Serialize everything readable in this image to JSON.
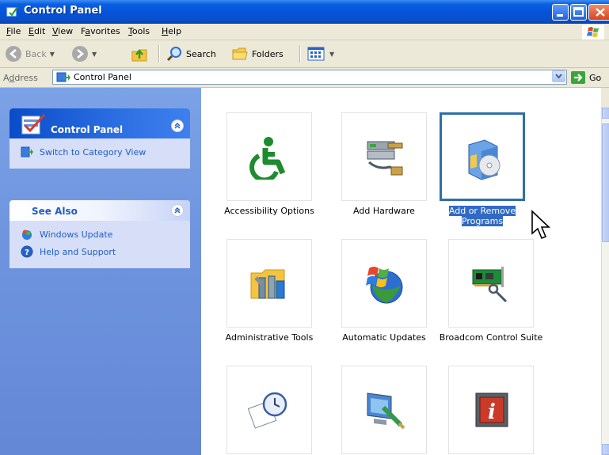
{
  "window": {
    "title": "Control Panel"
  },
  "menu": [
    {
      "label": "File",
      "mnemonic": "F",
      "rest": "ile"
    },
    {
      "label": "Edit",
      "mnemonic": "E",
      "rest": "dit"
    },
    {
      "label": "View",
      "mnemonic": "V",
      "rest": "iew"
    },
    {
      "label": "Favorites",
      "pre": "F",
      "mnemonic": "a",
      "rest": "vorites"
    },
    {
      "label": "Tools",
      "mnemonic": "T",
      "rest": "ools"
    },
    {
      "label": "Help",
      "mnemonic": "H",
      "rest": "elp"
    }
  ],
  "toolbar": {
    "back_label": "Back",
    "search_label": "Search",
    "folders_label": "Folders"
  },
  "address": {
    "label_pre": "A",
    "label_mnemonic": "d",
    "label_rest": "dress",
    "value": "Control Panel",
    "go_label": "Go"
  },
  "taskpane": {
    "control_panel": {
      "title": "Control Panel",
      "links": [
        {
          "label": "Switch to Category View",
          "icon": "category-view-icon"
        }
      ]
    },
    "see_also": {
      "title": "See Also",
      "links": [
        {
          "label": "Windows Update",
          "icon": "windows-update-icon"
        },
        {
          "label": "Help and Support",
          "icon": "help-icon"
        }
      ]
    }
  },
  "items": [
    {
      "label": "Accessibility Options",
      "icon": "accessibility-icon"
    },
    {
      "label": "Add Hardware",
      "icon": "add-hardware-icon"
    },
    {
      "label_line1": "Add or Remove",
      "label_line2": "Programs",
      "icon": "add-remove-programs-icon",
      "selected": true
    },
    {
      "label": "Administrative Tools",
      "icon": "administrative-tools-icon"
    },
    {
      "label": "Automatic Updates",
      "icon": "automatic-updates-icon"
    },
    {
      "label": "Broadcom Control Suite",
      "icon": "broadcom-icon"
    },
    {
      "label": "",
      "icon": "date-time-icon"
    },
    {
      "label": "",
      "icon": "display-icon"
    },
    {
      "label": "",
      "icon": "info-icon"
    }
  ],
  "colors": {
    "titlebar": "#0552d8",
    "taskpane": "#6f95df",
    "selection": "#316ac5",
    "link": "#215dc6"
  }
}
